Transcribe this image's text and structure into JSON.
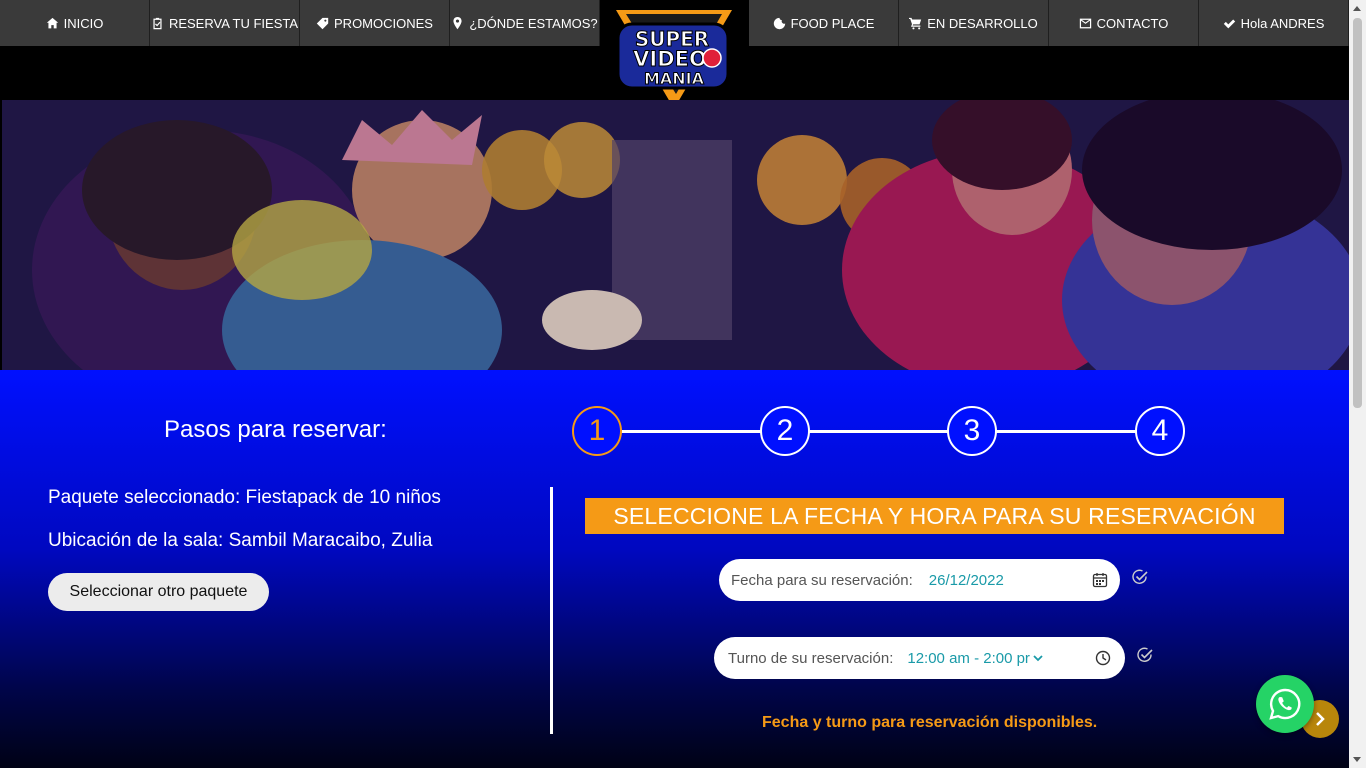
{
  "nav": {
    "items": [
      {
        "label": "INICIO",
        "icon": "home-icon"
      },
      {
        "label": "RESERVA TU FIESTA",
        "icon": "clipboard-check-icon"
      },
      {
        "label": "PROMOCIONES",
        "icon": "tag-icon"
      },
      {
        "label": "¿DÓNDE ESTAMOS?",
        "icon": "map-marker-icon"
      },
      {
        "label": "FOOD PLACE",
        "icon": "cookie-icon"
      },
      {
        "label": "EN DESARROLLO",
        "icon": "cart-icon"
      },
      {
        "label": "CONTACTO",
        "icon": "envelope-icon"
      },
      {
        "label": "Hola ANDRES",
        "icon": "checkmark-icon"
      }
    ],
    "logo": {
      "line1": "SUPER",
      "line2": "VIDEO",
      "line3": "MANIA"
    }
  },
  "main": {
    "steps_title": "Pasos para reservar:",
    "steps": [
      "1",
      "2",
      "3",
      "4"
    ],
    "active_step": 1,
    "package_line": "Paquete seleccionado: Fiestapack de 10 niños",
    "location_line": "Ubicación de la sala: Sambil Maracaibo, Zulia",
    "other_package_button": "Seleccionar otro paquete",
    "headline": "SELECCIONE LA FECHA Y HORA PARA SU RESERVACIÓN",
    "date_label": "Fecha para su reservación:",
    "date_value": "26/12/2022",
    "shift_label": "Turno de su reservación:",
    "shift_value": "12:00 am - 2:00 pr",
    "status": "Fecha y turno para reservación disponibles."
  },
  "colors": {
    "accent": "#f59a16",
    "blue": "#0010ff",
    "nav_bg": "#3a3a3a",
    "whatsapp": "#25d366",
    "field_value": "#1a9aa8"
  }
}
